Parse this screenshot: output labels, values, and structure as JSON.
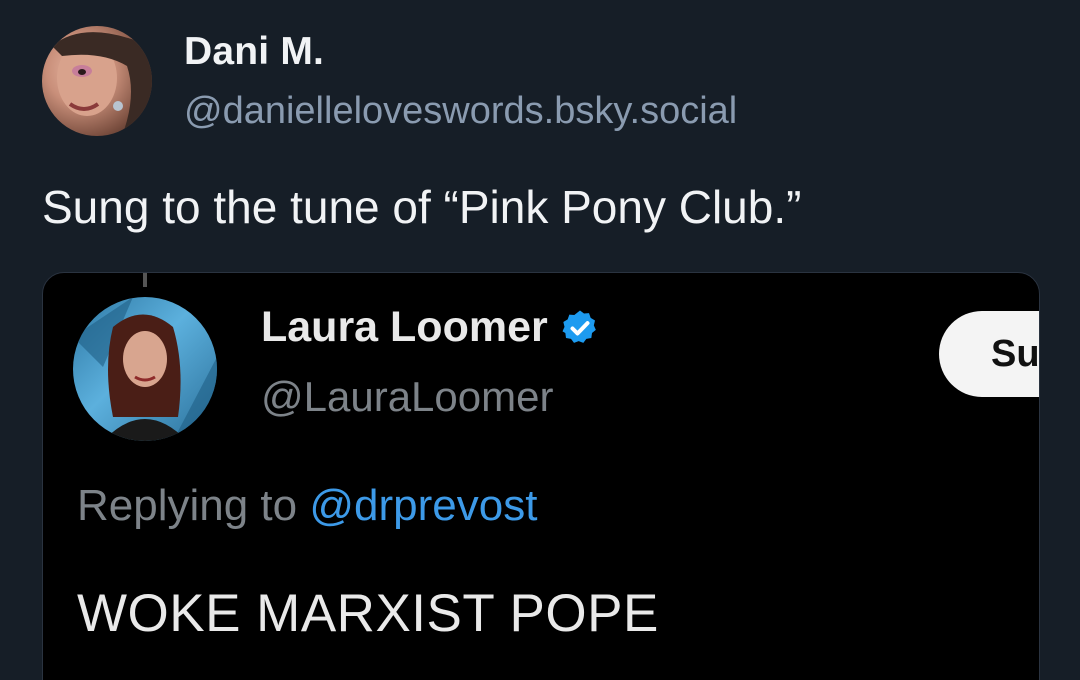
{
  "post": {
    "author_name": "Dani M.",
    "author_handle": "@danielleloveswords.bsky.social",
    "text": "Sung to the tune of “Pink Pony Club.”"
  },
  "quoted": {
    "author_name": "Laura Loomer",
    "author_handle": "@LauraLoomer",
    "verified": true,
    "verified_color": "#1d9bf0",
    "subscribe_label": "Su",
    "replying_prefix": "Replying to",
    "replying_mention": "@drprevost",
    "text": "WOKE MARXIST POPE"
  },
  "colors": {
    "background": "#161e27",
    "embed_background": "#000000",
    "handle": "#8a9bb0",
    "mention": "#3d9ae8"
  }
}
